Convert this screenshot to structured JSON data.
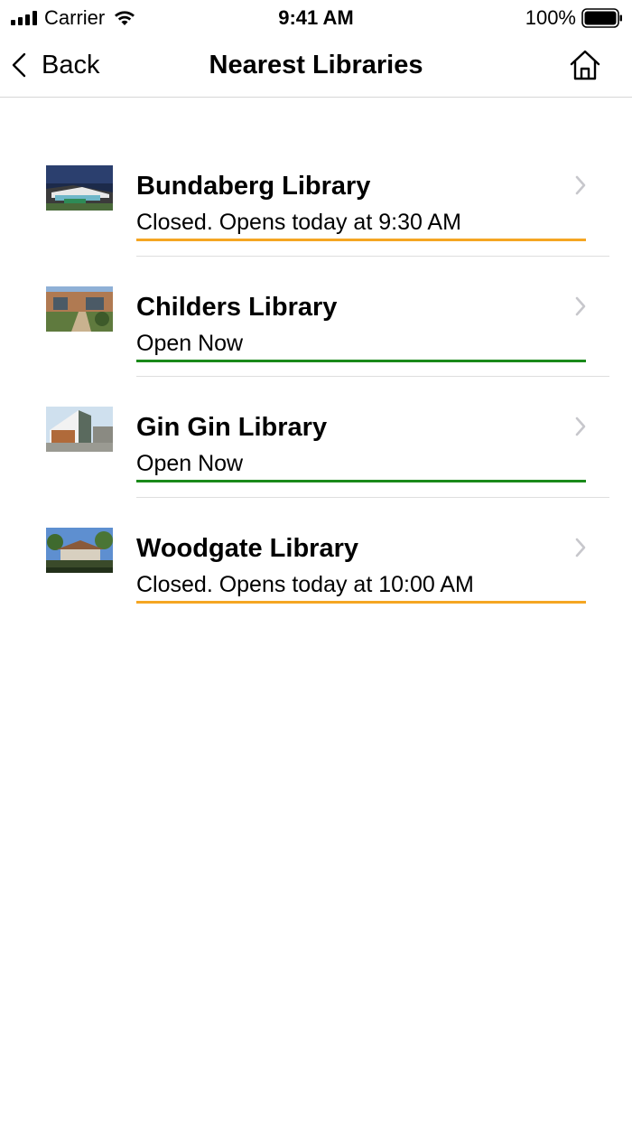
{
  "status_bar": {
    "carrier": "Carrier",
    "time": "9:41 AM",
    "battery": "100%"
  },
  "nav": {
    "back_label": "Back",
    "title": "Nearest Libraries",
    "home_icon": "home-icon"
  },
  "colors": {
    "closed": "#f5a623",
    "open": "#1a8a1a",
    "chevron": "#c7c7cc",
    "divider": "#dedede"
  },
  "libraries": [
    {
      "name": "Bundaberg Library",
      "status": "Closed. Opens today at 9:30 AM",
      "state": "closed"
    },
    {
      "name": "Childers Library",
      "status": "Open Now",
      "state": "open"
    },
    {
      "name": "Gin Gin Library",
      "status": "Open Now",
      "state": "open"
    },
    {
      "name": "Woodgate Library",
      "status": "Closed. Opens today at 10:00 AM",
      "state": "closed"
    }
  ]
}
